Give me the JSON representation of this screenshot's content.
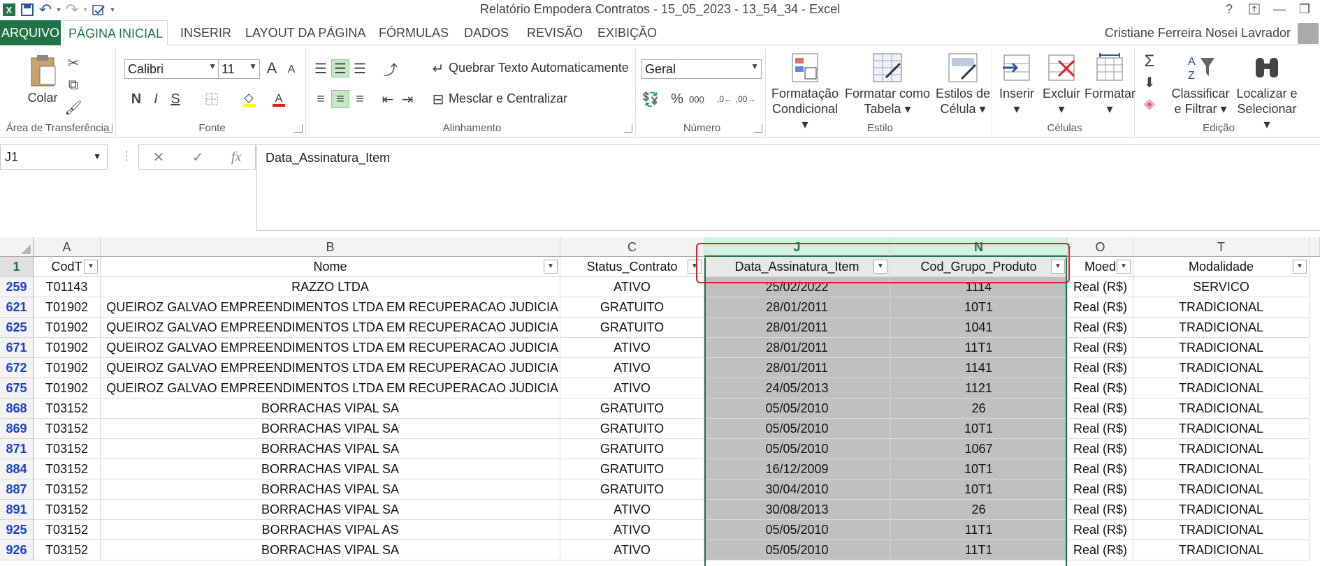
{
  "window": {
    "title": "Relatório Empodera Contratos - 15_05_2023 - 13_54_34 - Excel",
    "help": "?",
    "minimize": "—",
    "restore": "❐",
    "qat_more": "▾"
  },
  "tabs": [
    {
      "label": "ARQUIVO"
    },
    {
      "label": "PÁGINA INICIAL"
    },
    {
      "label": "INSERIR"
    },
    {
      "label": "LAYOUT DA PÁGINA"
    },
    {
      "label": "FÓRMULAS"
    },
    {
      "label": "DADOS"
    },
    {
      "label": "REVISÃO"
    },
    {
      "label": "EXIBIÇÃO"
    }
  ],
  "user": "Cristiane Ferreira Nosei Lavrador",
  "ribbon": {
    "clipboard": {
      "paste": "Colar",
      "label": "Área de Transferência"
    },
    "font": {
      "name": "Calibri",
      "size": "11",
      "bold": "N",
      "italic": "I",
      "underline": "S",
      "grow": "A",
      "shrink": "A",
      "label": "Fonte"
    },
    "alignment": {
      "wrap": "Quebrar Texto Automaticamente",
      "merge": "Mesclar e Centralizar",
      "label": "Alinhamento"
    },
    "number": {
      "format": "Geral",
      "percent": "%",
      "thousands": "000",
      "label": "Número"
    },
    "styles": {
      "conditional": "Formatação Condicional",
      "table": "Formatar como Tabela",
      "cell": "Estilos de Célula",
      "label": "Estilo"
    },
    "cells": {
      "insert": "Inserir",
      "delete": "Excluir",
      "format": "Formatar",
      "label": "Células"
    },
    "editing": {
      "sort": "Classificar e Filtrar",
      "find": "Localizar e Selecionar",
      "label": "Edição"
    }
  },
  "formula_bar": {
    "name_box": "J1",
    "fx": "fx",
    "value": "Data_Assinatura_Item"
  },
  "columns": [
    {
      "letter": "A",
      "header": "CodT",
      "filter": true
    },
    {
      "letter": "B",
      "header": "Nome",
      "filter": true
    },
    {
      "letter": "C",
      "header": "Status_Contrato",
      "filter": true
    },
    {
      "letter": "J",
      "header": "Data_Assinatura_Item",
      "filter": true
    },
    {
      "letter": "N",
      "header": "Cod_Grupo_Produto",
      "filter": true
    },
    {
      "letter": "O",
      "header": "Moed",
      "filter": true
    },
    {
      "letter": "T",
      "header": "Modalidade",
      "filter": true
    }
  ],
  "header_row_num": "1",
  "rows": [
    {
      "num": "259",
      "cells": [
        "T01143",
        "RAZZO LTDA",
        "ATIVO",
        "25/02/2022",
        "1114",
        "Real (R$)",
        "SERVICO"
      ]
    },
    {
      "num": "621",
      "cells": [
        "T01902",
        "QUEIROZ GALVAO EMPREENDIMENTOS LTDA EM RECUPERACAO JUDICIA",
        "GRATUITO",
        "28/01/2011",
        "10T1",
        "Real (R$)",
        "TRADICIONAL"
      ]
    },
    {
      "num": "625",
      "cells": [
        "T01902",
        "QUEIROZ GALVAO EMPREENDIMENTOS LTDA EM RECUPERACAO JUDICIA",
        "GRATUITO",
        "28/01/2011",
        "1041",
        "Real (R$)",
        "TRADICIONAL"
      ]
    },
    {
      "num": "671",
      "cells": [
        "T01902",
        "QUEIROZ GALVAO EMPREENDIMENTOS LTDA EM RECUPERACAO JUDICIA",
        "ATIVO",
        "28/01/2011",
        "11T1",
        "Real (R$)",
        "TRADICIONAL"
      ]
    },
    {
      "num": "672",
      "cells": [
        "T01902",
        "QUEIROZ GALVAO EMPREENDIMENTOS LTDA EM RECUPERACAO JUDICIA",
        "ATIVO",
        "28/01/2011",
        "1141",
        "Real (R$)",
        "TRADICIONAL"
      ]
    },
    {
      "num": "675",
      "cells": [
        "T01902",
        "QUEIROZ GALVAO EMPREENDIMENTOS LTDA EM RECUPERACAO JUDICIA",
        "ATIVO",
        "24/05/2013",
        "1121",
        "Real (R$)",
        "TRADICIONAL"
      ]
    },
    {
      "num": "868",
      "cells": [
        "T03152",
        "BORRACHAS VIPAL SA",
        "GRATUITO",
        "05/05/2010",
        "26",
        "Real (R$)",
        "TRADICIONAL"
      ]
    },
    {
      "num": "869",
      "cells": [
        "T03152",
        "BORRACHAS VIPAL SA",
        "GRATUITO",
        "05/05/2010",
        "10T1",
        "Real (R$)",
        "TRADICIONAL"
      ]
    },
    {
      "num": "871",
      "cells": [
        "T03152",
        "BORRACHAS VIPAL SA",
        "GRATUITO",
        "05/05/2010",
        "1067",
        "Real (R$)",
        "TRADICIONAL"
      ]
    },
    {
      "num": "884",
      "cells": [
        "T03152",
        "BORRACHAS VIPAL SA",
        "GRATUITO",
        "16/12/2009",
        "10T1",
        "Real (R$)",
        "TRADICIONAL"
      ]
    },
    {
      "num": "887",
      "cells": [
        "T03152",
        "BORRACHAS VIPAL SA",
        "GRATUITO",
        "30/04/2010",
        "10T1",
        "Real (R$)",
        "TRADICIONAL"
      ]
    },
    {
      "num": "891",
      "cells": [
        "T03152",
        "BORRACHAS VIPAL SA",
        "ATIVO",
        "30/08/2013",
        "26",
        "Real (R$)",
        "TRADICIONAL"
      ]
    },
    {
      "num": "925",
      "cells": [
        "T03152",
        "BORRACHAS VIPAL AS",
        "ATIVO",
        "05/05/2010",
        "11T1",
        "Real (R$)",
        "TRADICIONAL"
      ]
    },
    {
      "num": "926",
      "cells": [
        "T03152",
        "BORRACHAS VIPAL SA",
        "ATIVO",
        "05/05/2010",
        "11T1",
        "Real (R$)",
        "TRADICIONAL"
      ]
    }
  ],
  "colors": {
    "excel_green": "#217346",
    "selection_gray": "#c0c0c0",
    "highlight_red": "#e02020",
    "row_number_blue": "#1a3fcf"
  }
}
